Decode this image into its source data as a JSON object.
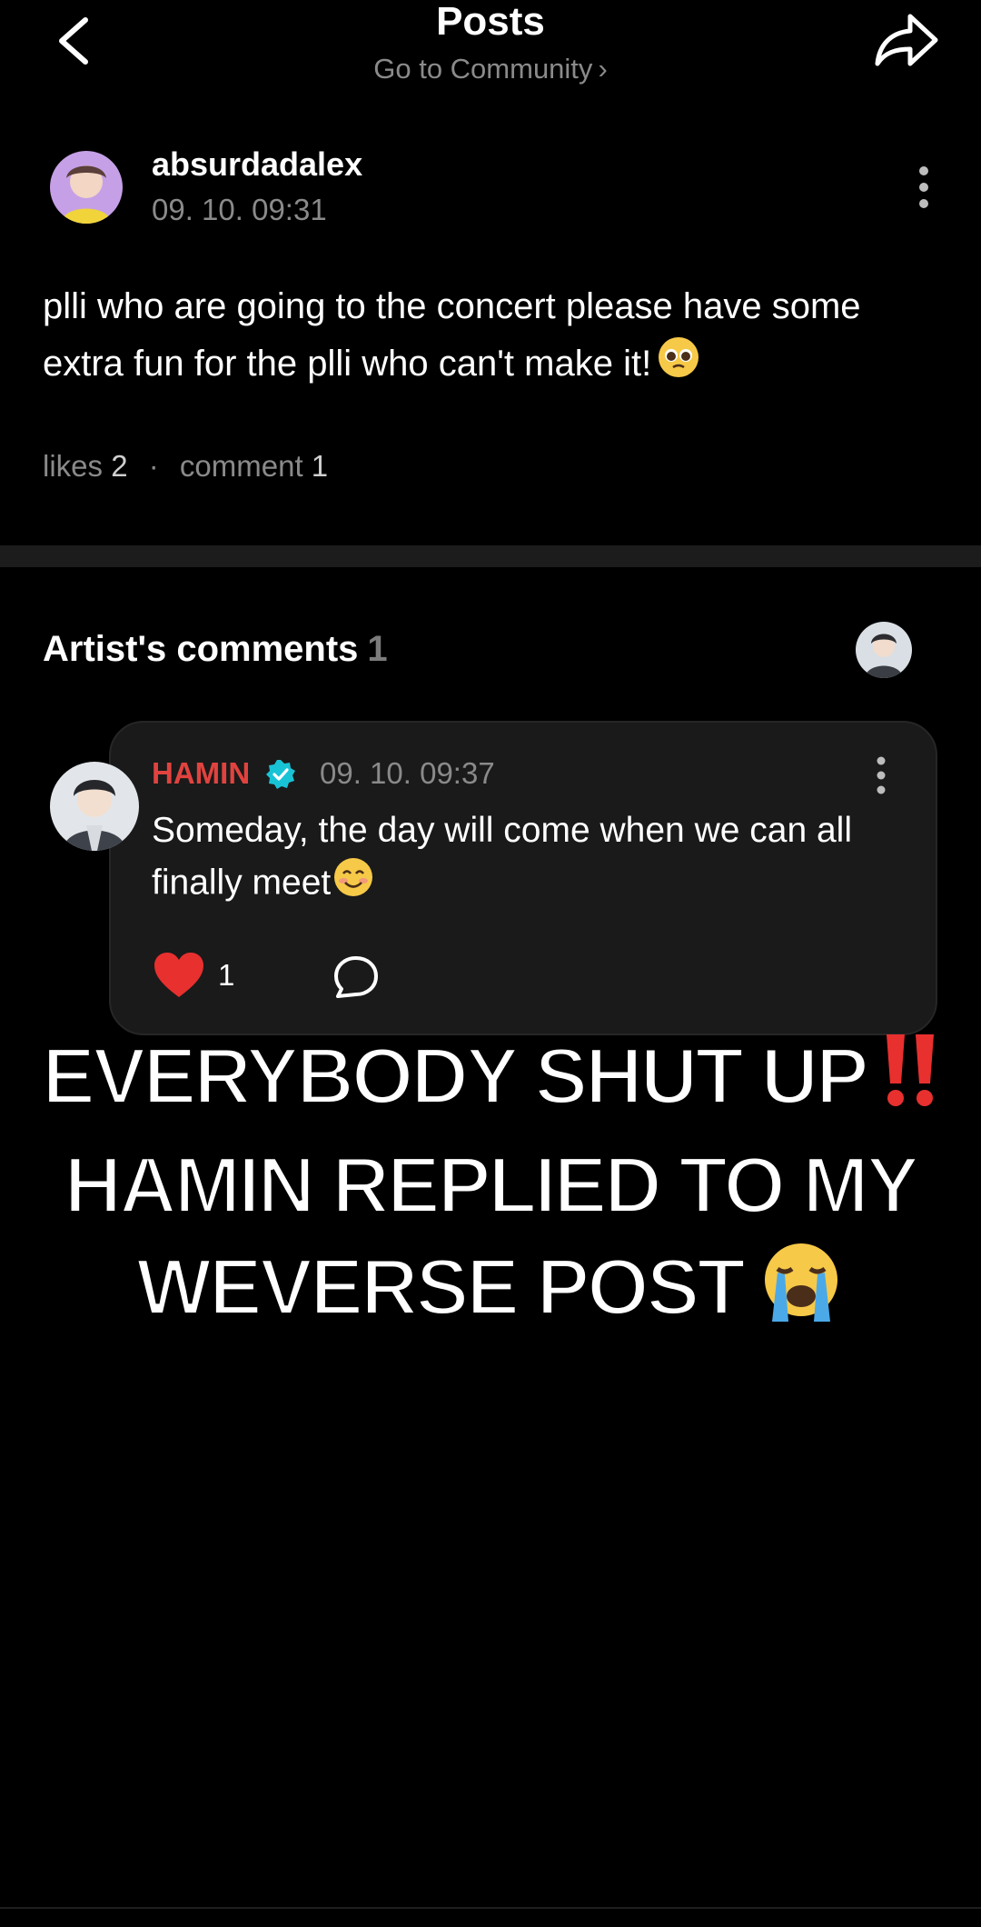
{
  "header": {
    "title": "Posts",
    "community_link": "Go to Community",
    "back_icon": "chevron-left-icon",
    "share_icon": "share-arrow-icon"
  },
  "post": {
    "author": "absurdadalex",
    "date": "09. 10. 09:31",
    "body": "plli who are going to the concert please have some extra fun for the plli who can't make it!",
    "body_emoji": "pleading-face-emoji",
    "likes_label": "likes",
    "likes_count": "2",
    "comments_label": "comment",
    "comments_count": "1"
  },
  "artist_comments": {
    "heading": "Artist's comments",
    "count": "1",
    "comment": {
      "author": "HAMIN",
      "author_color": "#e0433f",
      "date": "09. 10. 09:37",
      "text": "Someday, the day will come when we can all finally meet",
      "text_emoji": "smiling-face-emoji",
      "like_count": "1"
    }
  },
  "caption": {
    "line1": "EVERYBODY SHUT UP",
    "line2": "HAMIN REPLIED TO MY",
    "line3": "WEVERSE POST",
    "emoji1": "double-exclamation-emoji",
    "emoji3": "loudly-crying-face-emoji"
  },
  "colors": {
    "background": "#000000",
    "card": "#1a1a1a",
    "muted": "#8a8a8a",
    "heart": "#e8302f",
    "verified": "#19c3d6"
  }
}
